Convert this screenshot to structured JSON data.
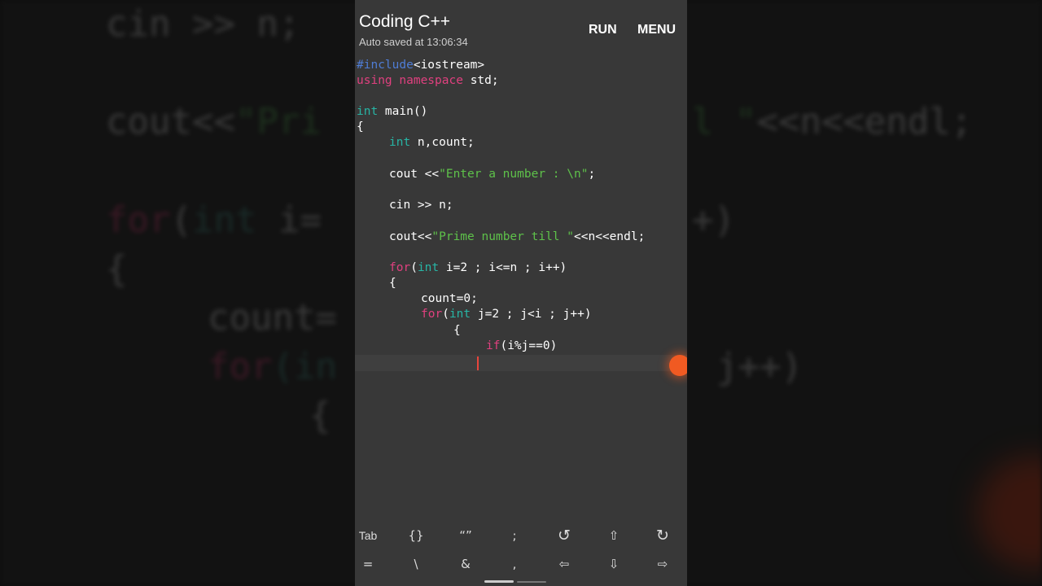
{
  "app": {
    "title": "Coding C++",
    "autosave": "Auto saved at 13:06:34",
    "run_label": "RUN",
    "menu_label": "MENU"
  },
  "code": {
    "l1_pp": "#include",
    "l1_rest": "<iostream>",
    "l2_kw1": "using",
    "l2_kw2": "namespace",
    "l2_rest": " std;",
    "l4_ty": "int",
    "l4_rest": " main()",
    "l5": "{",
    "l6_ty": "int",
    "l6_rest": " n,count;",
    "l8_a": "cout <<",
    "l8_str": "\"Enter a number : \\n\"",
    "l8_b": ";",
    "l10": "cin >> n;",
    "l12_a": "cout<<",
    "l12_str": "\"Prime number till \"",
    "l12_b": "<<n<<endl;",
    "l14_kw": "for",
    "l14_a": "(",
    "l14_ty": "int",
    "l14_b": " i=2 ; i<=n ; i++)",
    "l15": "{",
    "l16": "count=0;",
    "l17_kw": "for",
    "l17_a": "(",
    "l17_ty": "int",
    "l17_b": " j=2 ; j<i ; j++)",
    "l18": "{",
    "l19_kw": "if",
    "l19_b": "(i%j==0)"
  },
  "keyboard": {
    "row1": [
      "Tab",
      "{}",
      "“”",
      ";",
      "↺",
      "⇧",
      "↻"
    ],
    "row2": [
      "=",
      "\\",
      "&",
      ",",
      "⇦",
      "⇩",
      "⇨"
    ]
  },
  "bg": {
    "b1": "cin >> n;",
    "b2a": "cout<<",
    "b2s": "\"Pri",
    "b2s2": "l \"",
    "b2b": "<<n<<endl;",
    "b3kw": "for",
    "b3a": "(",
    "b3ty": "int",
    "b3b": " i=",
    "b3c": "+)",
    "b4": "{",
    "b5": "count=",
    "b6kw": "for",
    "b6a": "(in",
    "b6b": "j++)",
    "b7": "{"
  },
  "colors": {
    "preprocessor": "#4f7dd6",
    "keyword": "#e0407f",
    "type": "#27b5a5",
    "string": "#5ec14a",
    "caret": "#e8453c",
    "handle": "#f05a22"
  }
}
